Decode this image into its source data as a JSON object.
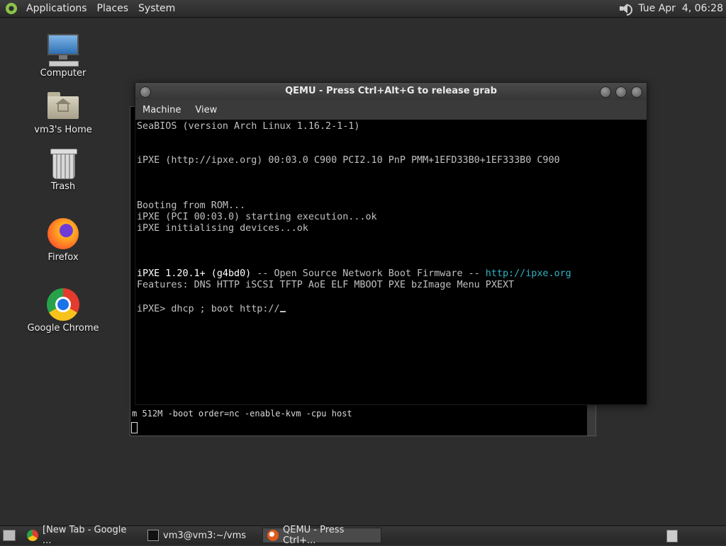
{
  "top_panel": {
    "menus": [
      "Applications",
      "Places",
      "System"
    ],
    "clock": "Tue Apr  4, 06:28"
  },
  "desktop": {
    "icons": [
      {
        "label": "Computer",
        "icon": "computer-icon"
      },
      {
        "label": "vm3's Home",
        "icon": "home-folder-icon"
      },
      {
        "label": "Trash",
        "icon": "trash-icon"
      },
      {
        "label": "Firefox",
        "icon": "firefox-icon"
      },
      {
        "label": "Google Chrome",
        "icon": "chrome-icon"
      }
    ]
  },
  "back_terminal": {
    "visible_line": "m 512M -boot order=nc -enable-kvm -cpu host"
  },
  "qemu": {
    "title": "QEMU - Press Ctrl+Alt+G to release grab",
    "menu": [
      "Machine",
      "View"
    ],
    "screen": {
      "bios_line": "SeaBIOS (version Arch Linux 1.16.2-1-1)",
      "ipxe_line": "iPXE (http://ipxe.org) 00:03.0 C900 PCI2.10 PnP PMM+1EFD33B0+1EF333B0 C900",
      "boot_rom": "Booting from ROM...",
      "starting": "iPXE (PCI 00:03.0) starting execution...ok",
      "init": "iPXE initialising devices...ok",
      "version_prefix": "iPXE 1.20.1+ (g4bd0)",
      "version_mid": " -- Open Source Network Boot Firmware -- ",
      "version_url": "http://ipxe.org",
      "features": "Features: DNS HTTP iSCSI TFTP AoE ELF MBOOT PXE bzImage Menu PXEXT",
      "prompt": "iPXE> dhcp ; boot http://"
    }
  },
  "taskbar": {
    "tasks": [
      {
        "label": "[New Tab - Google ...",
        "icon": "chrome-icon",
        "active": false
      },
      {
        "label": "vm3@vm3:~/vms",
        "icon": "terminal-icon",
        "active": false
      },
      {
        "label": "QEMU - Press Ctrl+...",
        "icon": "qemu-icon",
        "active": true
      }
    ]
  }
}
